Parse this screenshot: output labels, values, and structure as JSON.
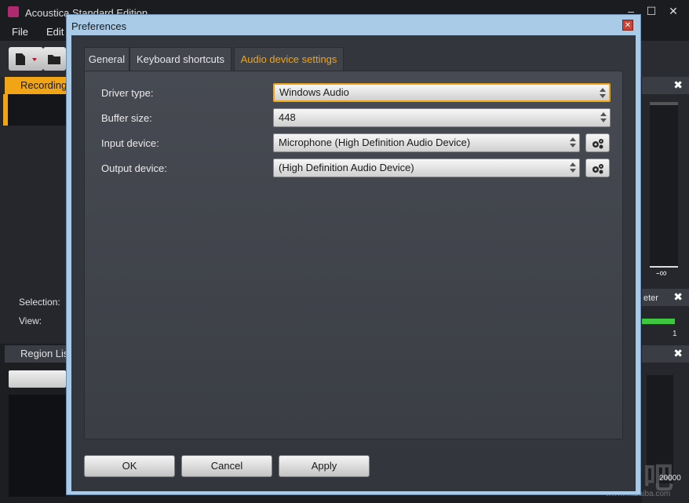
{
  "app": {
    "title": "Acoustica Standard Edition",
    "menu": [
      "File",
      "Edit"
    ],
    "recording_tab": "Recording",
    "selection_label": "Selection:",
    "view_label": "View:",
    "region_list_tab": "Region List",
    "meter_value": "-∞",
    "meter_panel_label": "eter",
    "meter_scale_value": "1",
    "spectrum_freq": "20000",
    "close_glyph": "✖"
  },
  "dialog": {
    "title": "Preferences",
    "close_glyph": "✕",
    "tabs": [
      {
        "label": "General",
        "active": false
      },
      {
        "label": "Keyboard shortcuts",
        "active": false
      },
      {
        "label": "Audio device settings",
        "active": true
      }
    ],
    "fields": {
      "driver_type": {
        "label": "Driver type:",
        "value": "Windows Audio"
      },
      "buffer_size": {
        "label": "Buffer size:",
        "value": "448"
      },
      "input_device": {
        "label": "Input device:",
        "value": "Microphone (High Definition Audio Device)"
      },
      "output_device": {
        "label": "Output device:",
        "value": "(High Definition Audio Device)"
      }
    },
    "buttons": {
      "ok": "OK",
      "cancel": "Cancel",
      "apply": "Apply"
    }
  },
  "colors": {
    "accent": "#f0a416",
    "dialog_frame": "#a9cbe8",
    "panel": "#33363c"
  },
  "watermark": {
    "text": "下载吧",
    "url": "www.xiazaiba.com"
  }
}
